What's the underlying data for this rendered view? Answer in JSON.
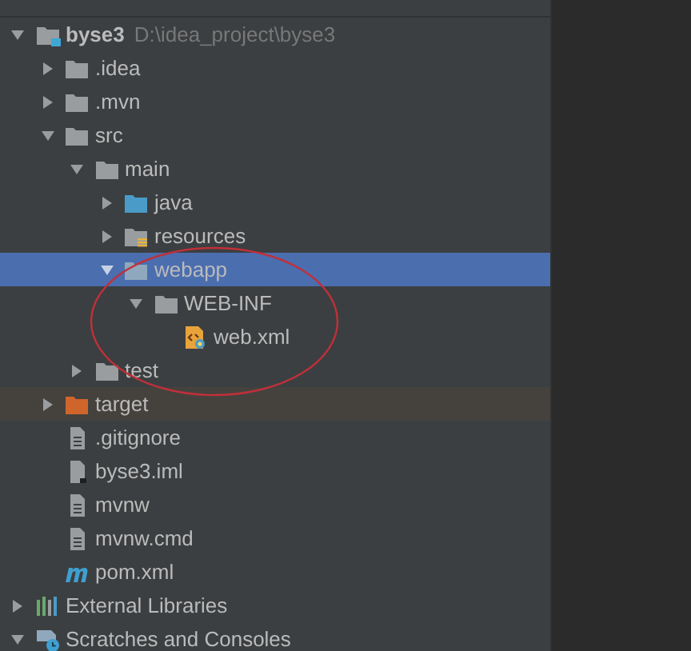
{
  "tree": [
    {
      "label": "byse3",
      "path": "D:\\idea_project\\byse3",
      "kind": "module",
      "expanded": true,
      "selected": false,
      "children": [
        {
          "label": ".idea",
          "kind": "folder",
          "expanded": false,
          "selected": false
        },
        {
          "label": ".mvn",
          "kind": "folder",
          "expanded": false,
          "selected": false
        },
        {
          "label": "src",
          "kind": "folder",
          "expanded": true,
          "selected": false,
          "children": [
            {
              "label": "main",
              "kind": "folder",
              "expanded": true,
              "selected": false,
              "children": [
                {
                  "label": "java",
                  "kind": "source-folder",
                  "expanded": false,
                  "selected": false
                },
                {
                  "label": "resources",
                  "kind": "resources-folder",
                  "expanded": false,
                  "selected": false
                },
                {
                  "label": "webapp",
                  "kind": "web-folder",
                  "expanded": true,
                  "selected": true,
                  "children": [
                    {
                      "label": "WEB-INF",
                      "kind": "folder",
                      "expanded": true,
                      "selected": false,
                      "children": [
                        {
                          "label": "web.xml",
                          "kind": "xml-file",
                          "selected": false
                        }
                      ]
                    }
                  ]
                }
              ]
            },
            {
              "label": "test",
              "kind": "folder",
              "expanded": false,
              "selected": false
            }
          ]
        },
        {
          "label": "target",
          "kind": "excluded-folder",
          "expanded": false,
          "selected": false
        },
        {
          "label": ".gitignore",
          "kind": "text-file",
          "selected": false
        },
        {
          "label": "byse3.iml",
          "kind": "iml-file",
          "selected": false
        },
        {
          "label": "mvnw",
          "kind": "text-file",
          "selected": false
        },
        {
          "label": "mvnw.cmd",
          "kind": "text-file",
          "selected": false
        },
        {
          "label": "pom.xml",
          "kind": "maven-file",
          "selected": false
        }
      ]
    },
    {
      "label": "External Libraries",
      "kind": "libraries",
      "expanded": false,
      "selected": false
    },
    {
      "label": "Scratches and Consoles",
      "kind": "scratches",
      "expanded": true,
      "selected": false
    }
  ]
}
